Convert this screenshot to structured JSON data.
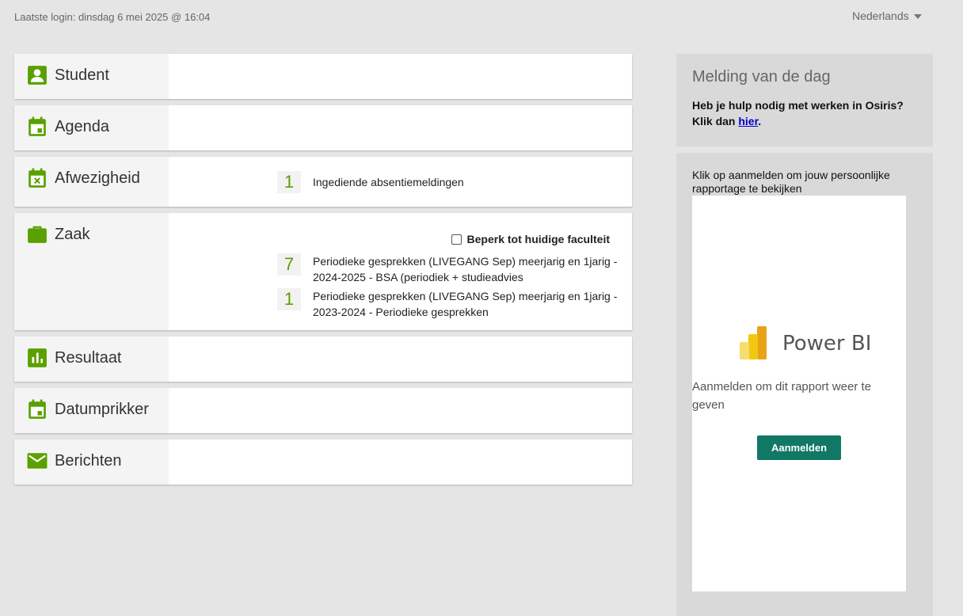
{
  "header": {
    "last_login": "Laatste login: dinsdag 6 mei 2025 @ 16:04",
    "language": "Nederlands"
  },
  "colors": {
    "accent": "#5aa000",
    "powerbi_button": "#117865"
  },
  "tiles": {
    "student": {
      "title": "Student",
      "icon": "person-icon"
    },
    "agenda": {
      "title": "Agenda",
      "icon": "calendar-icon"
    },
    "afwezigheid": {
      "title": "Afwezigheid",
      "icon": "calendar-x-icon",
      "items": [
        {
          "count": "1",
          "label": "Ingediende absentiemeldingen"
        }
      ]
    },
    "zaak": {
      "title": "Zaak",
      "icon": "briefcase-icon",
      "filter_label": "Beperk tot huidige faculteit",
      "items": [
        {
          "count": "7",
          "label": "Periodieke gesprekken (LIVEGANG Sep) meerjarig en 1jarig - 2024-2025 - BSA (periodiek + studieadvies"
        },
        {
          "count": "1",
          "label": "Periodieke gesprekken (LIVEGANG Sep) meerjarig en 1jarig - 2023-2024 - Periodieke gesprekken"
        }
      ]
    },
    "resultaat": {
      "title": "Resultaat",
      "icon": "bar-chart-icon"
    },
    "datumprikker": {
      "title": "Datumprikker",
      "icon": "calendar-icon"
    },
    "berichten": {
      "title": "Berichten",
      "icon": "mail-icon"
    }
  },
  "motd": {
    "title": "Melding van de dag",
    "line1": "Heb je hulp nodig met werken in Osiris?",
    "line2_prefix": "Klik dan ",
    "link": "hier",
    "line2_suffix": "."
  },
  "report": {
    "intro": "Klik op aanmelden om jouw persoonlijke rapportage te bekijken",
    "product": "Power BI",
    "message": "Aanmelden om dit rapport weer te geven",
    "button": "Aanmelden"
  }
}
